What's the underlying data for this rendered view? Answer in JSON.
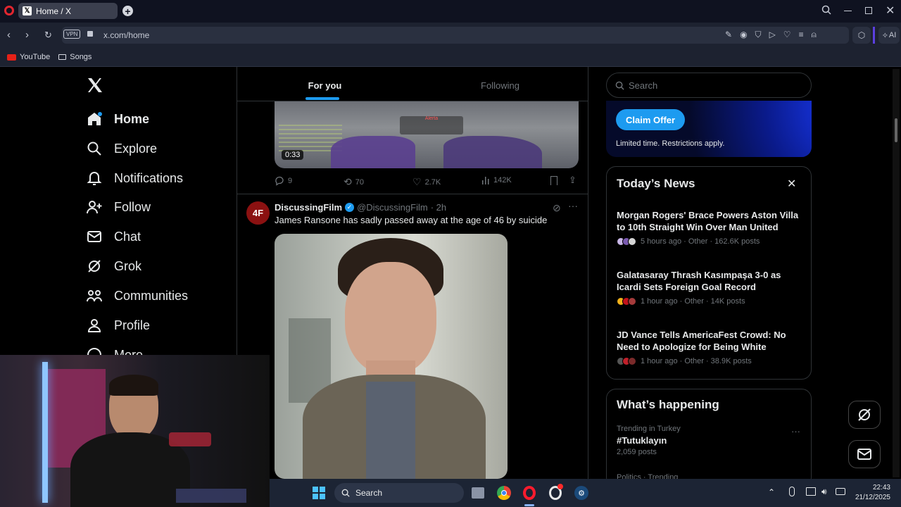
{
  "browser": {
    "tab_title": "Home / X",
    "url": "x.com/home",
    "vpn_label": "VPN",
    "ai_label": "AI",
    "bookmarks": [
      {
        "label": "YouTube"
      },
      {
        "label": "Songs"
      }
    ]
  },
  "sidebar": {
    "logo": "X",
    "items": [
      {
        "label": "Home",
        "icon": "home-icon"
      },
      {
        "label": "Explore",
        "icon": "search-icon"
      },
      {
        "label": "Notifications",
        "icon": "bell-icon"
      },
      {
        "label": "Follow",
        "icon": "add-user-icon"
      },
      {
        "label": "Chat",
        "icon": "mail-icon"
      },
      {
        "label": "Grok",
        "icon": "grok-icon"
      },
      {
        "label": "Communities",
        "icon": "people-icon"
      },
      {
        "label": "Profile",
        "icon": "user-icon"
      },
      {
        "label": "More",
        "icon": "more-icon"
      }
    ]
  },
  "feed": {
    "tabs": [
      {
        "label": "For you",
        "active": true
      },
      {
        "label": "Following",
        "active": false
      }
    ],
    "prev_post": {
      "video_time": "0:33",
      "video_overlay_text": "Alerta",
      "replies": "9",
      "reposts": "70",
      "likes": "2.7K",
      "views": "142K"
    },
    "post": {
      "avatar_text": "4F",
      "name": "DiscussingFilm",
      "handle": "@DiscussingFilm",
      "time": "· 2h",
      "text": "James Ransone has sadly passed away at the age of 46 by suicide"
    }
  },
  "right": {
    "search_placeholder": "Search",
    "promo": {
      "button": "Claim Offer",
      "note": "Limited time. Restrictions apply."
    },
    "news": {
      "title": "Today’s News",
      "items": [
        {
          "title": "Morgan Rogers' Brace Powers Aston Villa to 10th Straight Win Over Man United",
          "meta": "5 hours ago · Other · 162.6K posts"
        },
        {
          "title": "Galatasaray Thrash Kasımpaşa 3-0 as Icardi Sets Foreign Goal Record",
          "meta": "1 hour ago · Other · 14K posts"
        },
        {
          "title": "JD Vance Tells AmericaFest Crowd: No Need to Apologize for Being White",
          "meta": "1 hour ago · Other · 38.9K posts"
        }
      ]
    },
    "happening": {
      "title": "What’s happening",
      "trend_context": "Trending in Turkey",
      "trend_name": "#Tutuklayın",
      "trend_count": "2,059 posts",
      "next_context": "Politics · Trending"
    }
  },
  "taskbar": {
    "search_label": "Search",
    "time": "22:43",
    "date": "21/12/2025"
  },
  "colors": {
    "accent": "#1d9bf0",
    "chrome": "#1d2230",
    "taskbar": "#1c2434"
  }
}
